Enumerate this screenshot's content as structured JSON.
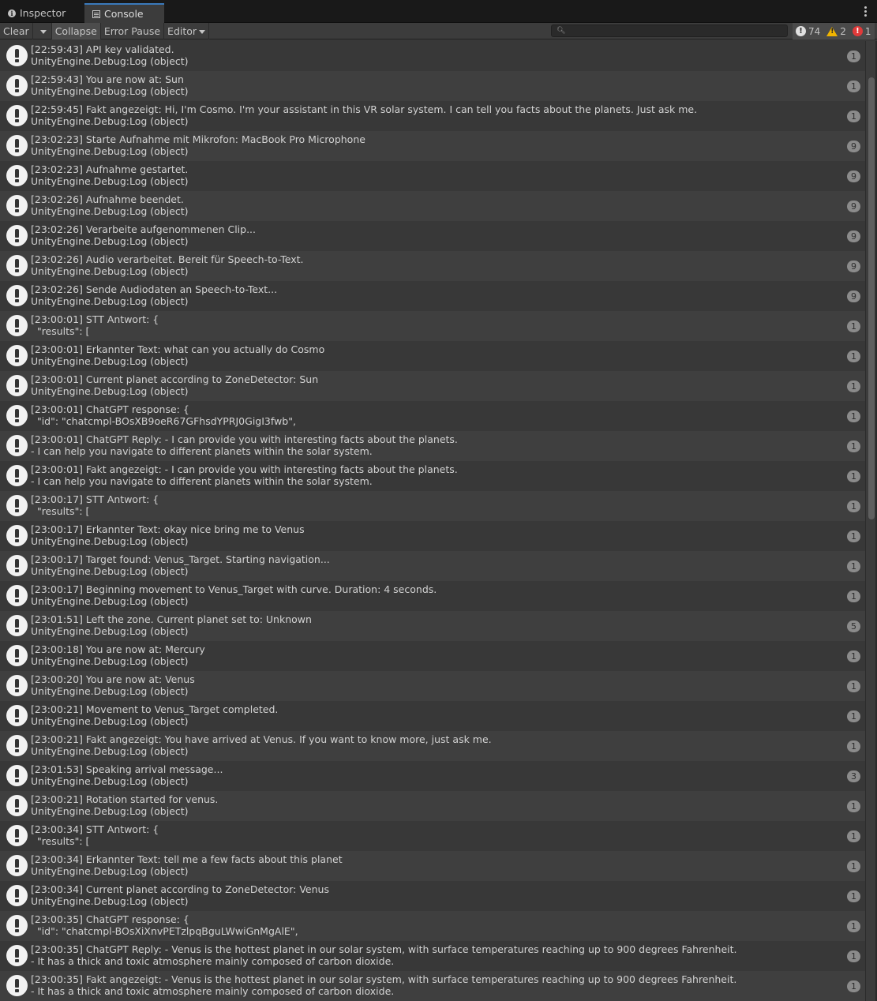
{
  "tabs": [
    {
      "label": "Inspector",
      "icon": "info-icon"
    },
    {
      "label": "Console",
      "icon": "console-icon"
    }
  ],
  "toolbar": {
    "clear": "Clear",
    "collapse": "Collapse",
    "error_pause": "Error Pause",
    "editor": "Editor",
    "search_placeholder": ""
  },
  "counters": {
    "info": "74",
    "warning": "2",
    "error": "1"
  },
  "entries": [
    {
      "l1": "[22:59:43] API key validated.",
      "l2": "UnityEngine.Debug:Log (object)",
      "count": "1"
    },
    {
      "l1": "[22:59:43] You are now at: Sun",
      "l2": "UnityEngine.Debug:Log (object)",
      "count": "1"
    },
    {
      "l1": "[22:59:45] Fakt angezeigt: Hi, I'm Cosmo. I'm your assistant in this VR solar system. I can tell you facts about the planets. Just ask me.",
      "l2": "UnityEngine.Debug:Log (object)",
      "count": "1"
    },
    {
      "l1": "[23:02:23] Starte Aufnahme mit Mikrofon: MacBook Pro Microphone",
      "l2": "UnityEngine.Debug:Log (object)",
      "count": "9"
    },
    {
      "l1": "[23:02:23] Aufnahme gestartet.",
      "l2": "UnityEngine.Debug:Log (object)",
      "count": "9"
    },
    {
      "l1": "[23:02:26] Aufnahme beendet.",
      "l2": "UnityEngine.Debug:Log (object)",
      "count": "9"
    },
    {
      "l1": "[23:02:26] Verarbeite aufgenommenen Clip...",
      "l2": "UnityEngine.Debug:Log (object)",
      "count": "9"
    },
    {
      "l1": "[23:02:26] Audio verarbeitet. Bereit für Speech-to-Text.",
      "l2": "UnityEngine.Debug:Log (object)",
      "count": "9"
    },
    {
      "l1": "[23:02:26] Sende Audiodaten an Speech-to-Text...",
      "l2": "UnityEngine.Debug:Log (object)",
      "count": "9"
    },
    {
      "l1": "[23:00:01] STT Antwort: {",
      "l2": "  \"results\": [",
      "count": "1"
    },
    {
      "l1": "[23:00:01] Erkannter Text: what can you actually do Cosmo",
      "l2": "UnityEngine.Debug:Log (object)",
      "count": "1"
    },
    {
      "l1": "[23:00:01] Current planet according to ZoneDetector: Sun",
      "l2": "UnityEngine.Debug:Log (object)",
      "count": "1"
    },
    {
      "l1": "[23:00:01] ChatGPT response: {",
      "l2": "  \"id\": \"chatcmpl-BOsXB9oeR67GFhsdYPRJ0GigI3fwb\",",
      "count": "1"
    },
    {
      "l1": "[23:00:01] ChatGPT Reply: - I can provide you with interesting facts about the planets.",
      "l2": "- I can help you navigate to different planets within the solar system.",
      "count": "1"
    },
    {
      "l1": "[23:00:01] Fakt angezeigt: - I can provide you with interesting facts about the planets.",
      "l2": "- I can help you navigate to different planets within the solar system.",
      "count": "1"
    },
    {
      "l1": "[23:00:17] STT Antwort: {",
      "l2": "  \"results\": [",
      "count": "1"
    },
    {
      "l1": "[23:00:17] Erkannter Text: okay nice bring me to Venus",
      "l2": "UnityEngine.Debug:Log (object)",
      "count": "1"
    },
    {
      "l1": "[23:00:17] Target found: Venus_Target. Starting navigation...",
      "l2": "UnityEngine.Debug:Log (object)",
      "count": "1"
    },
    {
      "l1": "[23:00:17] Beginning movement to Venus_Target with curve. Duration: 4 seconds.",
      "l2": "UnityEngine.Debug:Log (object)",
      "count": "1"
    },
    {
      "l1": "[23:01:51] Left the zone. Current planet set to: Unknown",
      "l2": "UnityEngine.Debug:Log (object)",
      "count": "5"
    },
    {
      "l1": "[23:00:18] You are now at: Mercury",
      "l2": "UnityEngine.Debug:Log (object)",
      "count": "1"
    },
    {
      "l1": "[23:00:20] You are now at: Venus",
      "l2": "UnityEngine.Debug:Log (object)",
      "count": "1"
    },
    {
      "l1": "[23:00:21] Movement to Venus_Target completed.",
      "l2": "UnityEngine.Debug:Log (object)",
      "count": "1"
    },
    {
      "l1": "[23:00:21] Fakt angezeigt: You have arrived at Venus. If you want to know more, just ask me.",
      "l2": "UnityEngine.Debug:Log (object)",
      "count": "1"
    },
    {
      "l1": "[23:01:53] Speaking arrival message...",
      "l2": "UnityEngine.Debug:Log (object)",
      "count": "3"
    },
    {
      "l1": "[23:00:21] Rotation started for venus.",
      "l2": "UnityEngine.Debug:Log (object)",
      "count": "1"
    },
    {
      "l1": "[23:00:34] STT Antwort: {",
      "l2": "  \"results\": [",
      "count": "1"
    },
    {
      "l1": "[23:00:34] Erkannter Text: tell me a few facts about this planet",
      "l2": "UnityEngine.Debug:Log (object)",
      "count": "1"
    },
    {
      "l1": "[23:00:34] Current planet according to ZoneDetector: Venus",
      "l2": "UnityEngine.Debug:Log (object)",
      "count": "1"
    },
    {
      "l1": "[23:00:35] ChatGPT response: {",
      "l2": "  \"id\": \"chatcmpl-BOsXiXnvPETzlpqBguLWwiGnMgAlE\",",
      "count": "1"
    },
    {
      "l1": "[23:00:35] ChatGPT Reply: - Venus is the hottest planet in our solar system, with surface temperatures reaching up to 900 degrees Fahrenheit.",
      "l2": "- It has a thick and toxic atmosphere mainly composed of carbon dioxide.",
      "count": "1"
    },
    {
      "l1": "[23:00:35] Fakt angezeigt: - Venus is the hottest planet in our solar system, with surface temperatures reaching up to 900 degrees Fahrenheit.",
      "l2": "- It has a thick and toxic atmosphere mainly composed of carbon dioxide.",
      "count": "1"
    }
  ]
}
